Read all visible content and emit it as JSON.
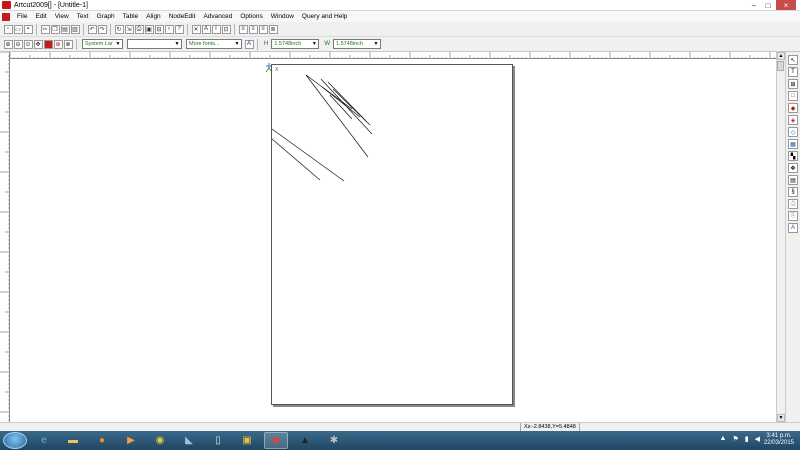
{
  "window": {
    "title": "Artcut2009[] - [Untitle-1]"
  },
  "menu": [
    "File",
    "Edit",
    "View",
    "Text",
    "Graph",
    "Table",
    "Align",
    "NodeEdit",
    "Advanced",
    "Options",
    "Window",
    "Query and Help"
  ],
  "toolbar2": {
    "font_system": "System Lar",
    "font_name": "",
    "more_fonts": "More fonts...",
    "h_label": "H",
    "h_value": "1.5748inch",
    "w_label": "W",
    "w_value": "1.5748inch"
  },
  "canvas": {
    "origin_label": "X"
  },
  "status": {
    "coords": "Xs:-2.8438,Y=5.4848"
  },
  "taskbar": {
    "time": "3:41 p.m.",
    "date": "22/03/2015"
  },
  "colors": {
    "accent": "#c41a1a",
    "font_green": "#1a7a1a",
    "taskbar": "#2a5370"
  }
}
